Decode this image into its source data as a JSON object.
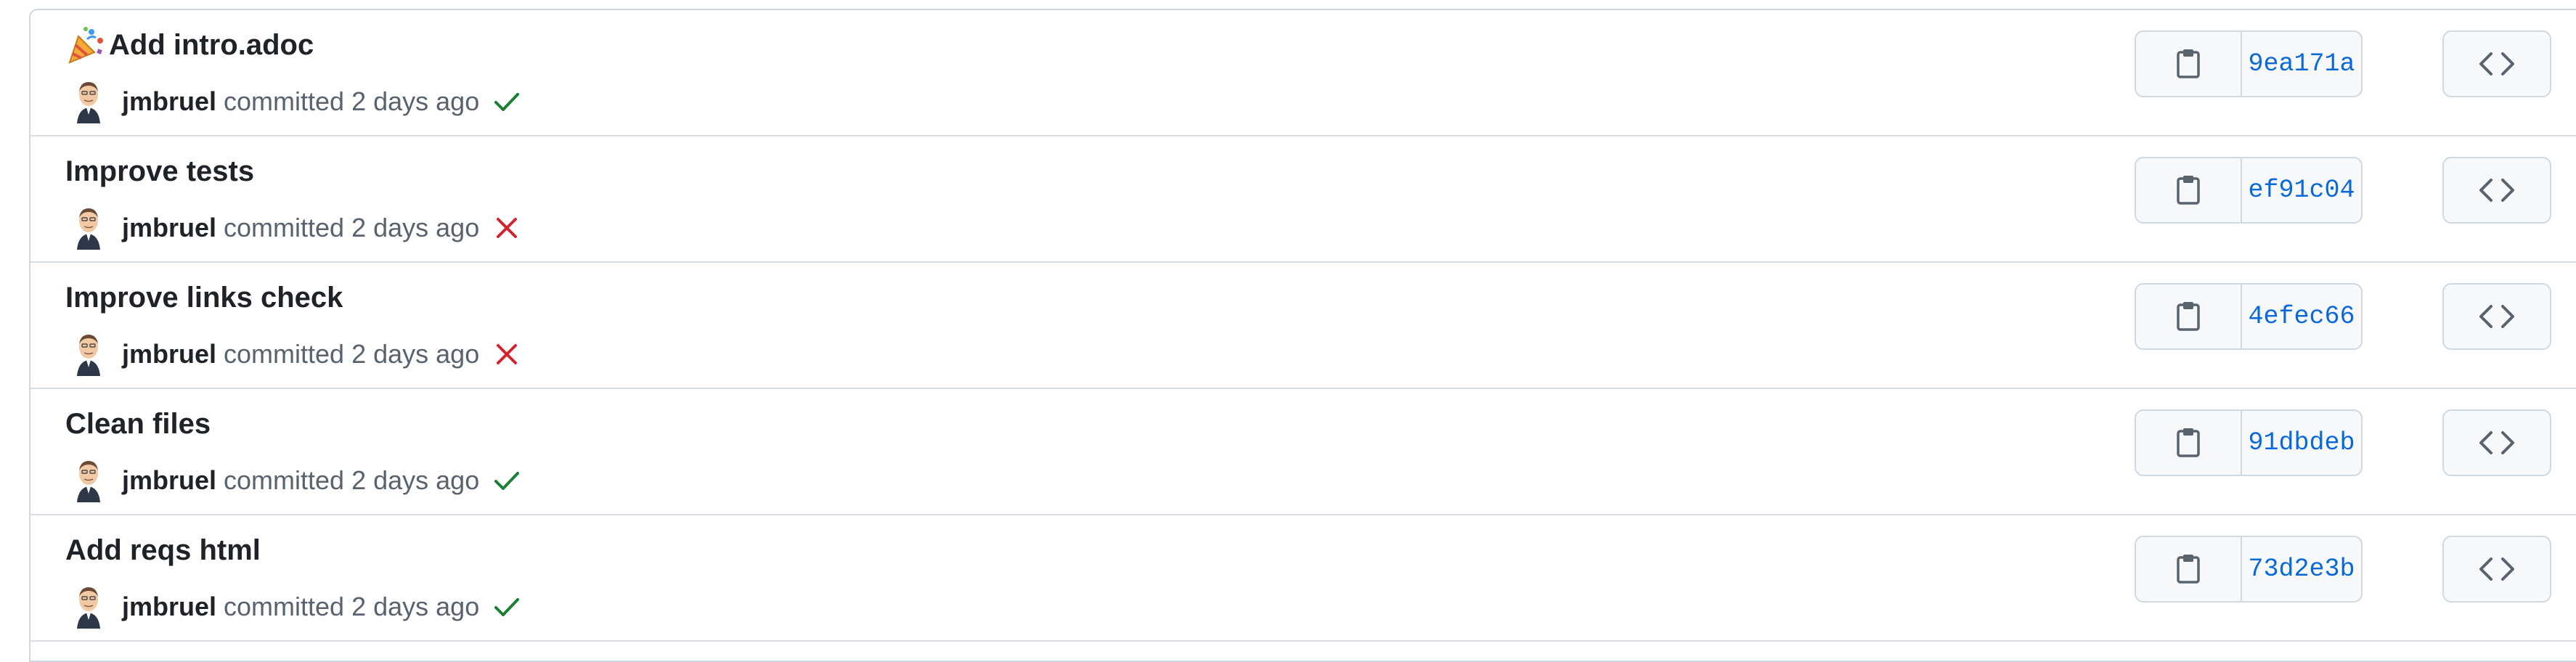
{
  "commits": [
    {
      "title": "Add intro.adoc",
      "emoji": "tada-icon",
      "author": "jmbruel",
      "meta": "committed 2 days ago",
      "status": "success",
      "sha": "9ea171a"
    },
    {
      "title": "Improve tests",
      "emoji": null,
      "author": "jmbruel",
      "meta": "committed 2 days ago",
      "status": "failure",
      "sha": "ef91c04"
    },
    {
      "title": "Improve links check",
      "emoji": null,
      "author": "jmbruel",
      "meta": "committed 2 days ago",
      "status": "failure",
      "sha": "4efec66"
    },
    {
      "title": "Clean files",
      "emoji": null,
      "author": "jmbruel",
      "meta": "committed 2 days ago",
      "status": "success",
      "sha": "91dbdeb"
    },
    {
      "title": "Add reqs html",
      "emoji": null,
      "author": "jmbruel",
      "meta": "committed 2 days ago",
      "status": "success",
      "sha": "73d2e3b"
    }
  ],
  "icons": {
    "copy": "copy-icon",
    "browse": "code-icon",
    "success": "check-icon",
    "failure": "x-icon"
  },
  "colors": {
    "success": "#1a7f37",
    "failure": "#d1242f",
    "sha": "#0969da",
    "border": "#d0d7de",
    "button_bg": "#f6f8fa"
  }
}
